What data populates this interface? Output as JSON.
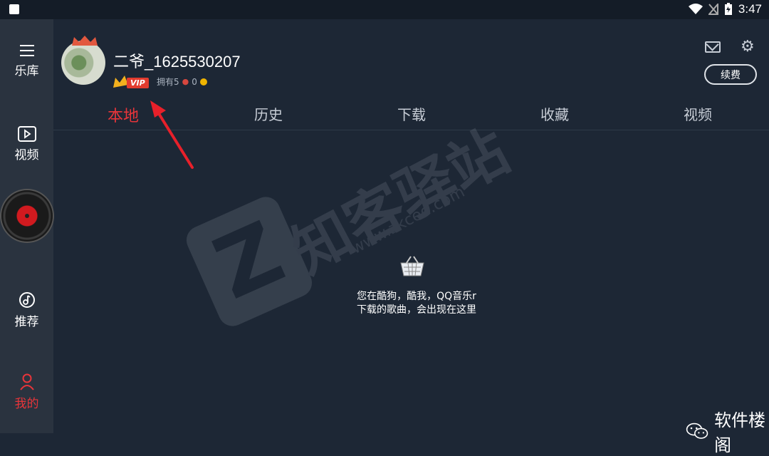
{
  "status": {
    "time": "3:47"
  },
  "sidebar": {
    "items": [
      {
        "label": "乐库",
        "icon": "menu-icon"
      },
      {
        "label": "视频",
        "icon": "video-icon"
      },
      {
        "label": "推荐",
        "icon": "music-note-icon"
      },
      {
        "label": "我的",
        "icon": "person-icon"
      }
    ]
  },
  "profile": {
    "username": "二爷_1625530207",
    "vip_label": "VIP",
    "owns_label": "拥有5",
    "owns_count": "0",
    "renew_label": "续费"
  },
  "tabs": [
    "本地",
    "历史",
    "下载",
    "收藏",
    "视频"
  ],
  "empty_state": {
    "line1": "您在酷狗，酷我，QQ音乐r",
    "line2": "下载的歌曲，会出现在这里"
  },
  "watermark": {
    "brand": "知客驿站",
    "url": "www.zkcee.com"
  },
  "brand_footer": {
    "label": "软件楼阁"
  },
  "colors": {
    "accent": "#e8353a",
    "background": "#1d2735",
    "sidebar": "#2a333f"
  }
}
